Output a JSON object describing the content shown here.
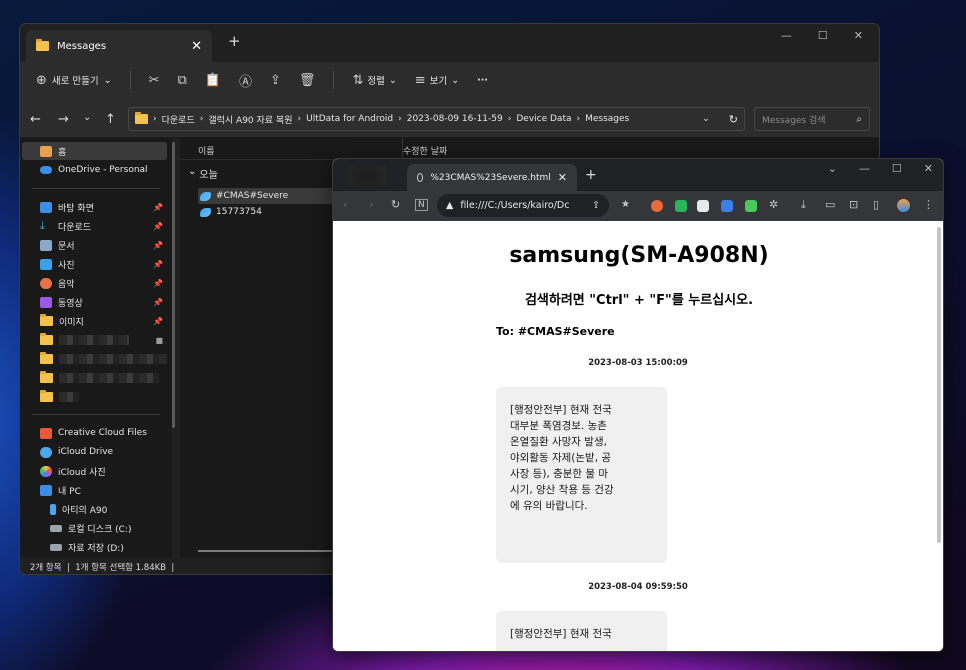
{
  "explorer": {
    "tab_title": "Messages",
    "toolbar": {
      "new_label": "새로 만들기",
      "sort_label": "정렬",
      "view_label": "보기",
      "more_label": "···"
    },
    "path": [
      "다운로드",
      "갤럭시 A90 자료 복원",
      "UltData for Android",
      "2023-08-09 16-11-59",
      "Device Data",
      "Messages"
    ],
    "search_placeholder": "Messages 검색",
    "sidebar": {
      "home": "홈",
      "onedrive": "OneDrive - Personal",
      "quick": [
        {
          "label": "바탕 화면",
          "color": "#3a8ee6"
        },
        {
          "label": "다운로드",
          "color": "#3ab0d0"
        },
        {
          "label": "문서",
          "color": "#8aa8c8"
        },
        {
          "label": "사진",
          "color": "#3aa0e8"
        },
        {
          "label": "음악",
          "color": "#e8704a"
        },
        {
          "label": "동영상",
          "color": "#9a5ae8"
        },
        {
          "label": "이미지",
          "color": "#f2c14e"
        }
      ],
      "cloud": [
        "Creative Cloud Files",
        "iCloud Drive",
        "iCloud 사진"
      ],
      "pc": "내 PC",
      "drives": [
        "아티의 A90",
        "로컬 디스크 (C:)",
        "자료 저장 (D:)"
      ]
    },
    "columns": {
      "name": "이름",
      "modified": "수정한 날짜"
    },
    "group_label": "오늘",
    "files": [
      "#CMAS#Severe",
      "15773754"
    ],
    "status": "2개 항목  |  1개 항목 선택함 1.84KB  |"
  },
  "browser": {
    "tab_title": "%23CMAS%23Severe.html",
    "url": "file:///C:/Users/kairo/Dc",
    "page": {
      "device": "samsung(SM-A908N)",
      "hint": "검색하려면 \"Ctrl\" + \"F\"를 누르십시오.",
      "to": "To: #CMAS#Severe",
      "messages": [
        {
          "time": "2023-08-03 15:00:09",
          "text": "[행정안전부] 현재 전국\n대부분 폭염경보. 농촌\n온열질환 사망자 발생,\n야외활동 자제(논밭, 공\n사장 등), 충분한 물 마\n시기, 양산 착용 등 건강\n에 유의 바랍니다."
        },
        {
          "time": "2023-08-04 09:59:50",
          "text": "[행정안전부] 현재 전국"
        }
      ]
    }
  }
}
